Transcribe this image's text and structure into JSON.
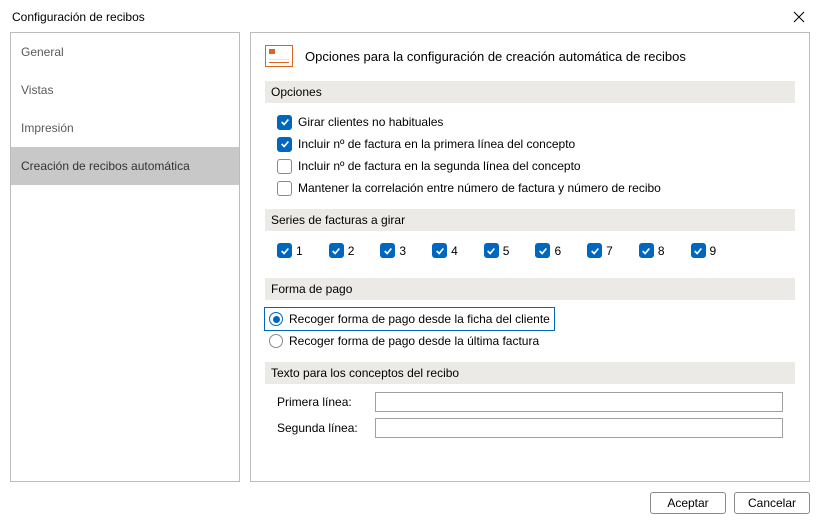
{
  "window": {
    "title": "Configuración de recibos"
  },
  "sidebar": {
    "items": [
      {
        "label": "General",
        "active": false
      },
      {
        "label": "Vistas",
        "active": false
      },
      {
        "label": "Impresión",
        "active": false
      },
      {
        "label": "Creación de recibos automática",
        "active": true
      }
    ]
  },
  "main": {
    "header": "Opciones para la configuración de creación automática de recibos",
    "sections": {
      "opciones": {
        "title": "Opciones",
        "items": [
          {
            "label": "Girar clientes no habituales",
            "checked": true
          },
          {
            "label": "Incluir nº de factura en la primera línea del concepto",
            "checked": true
          },
          {
            "label": "Incluir nº de factura en la segunda línea del concepto",
            "checked": false
          },
          {
            "label": "Mantener la correlación entre número de factura y número de recibo",
            "checked": false
          }
        ]
      },
      "series": {
        "title": "Series de facturas a girar",
        "items": [
          {
            "label": "1",
            "checked": true
          },
          {
            "label": "2",
            "checked": true
          },
          {
            "label": "3",
            "checked": true
          },
          {
            "label": "4",
            "checked": true
          },
          {
            "label": "5",
            "checked": true
          },
          {
            "label": "6",
            "checked": true
          },
          {
            "label": "7",
            "checked": true
          },
          {
            "label": "8",
            "checked": true
          },
          {
            "label": "9",
            "checked": true
          }
        ]
      },
      "formaPago": {
        "title": "Forma de pago",
        "options": [
          {
            "label": "Recoger forma de pago desde la ficha del cliente",
            "selected": true
          },
          {
            "label": "Recoger forma de pago desde la última factura",
            "selected": false
          }
        ]
      },
      "texto": {
        "title": "Texto para los conceptos del recibo",
        "primera_label": "Primera línea:",
        "primera_value": "",
        "segunda_label": "Segunda línea:",
        "segunda_value": ""
      }
    }
  },
  "footer": {
    "accept": "Aceptar",
    "cancel": "Cancelar"
  }
}
